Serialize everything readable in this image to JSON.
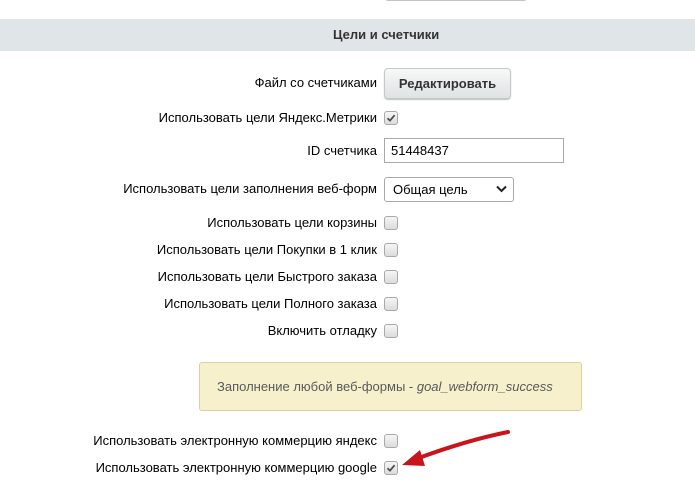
{
  "section": {
    "title": "Цели и счетчики"
  },
  "counters_file": {
    "label": "Файл со счетчиками",
    "button_label": "Редактировать"
  },
  "use_yandex_goals": {
    "label": "Использовать цели Яндекс.Метрики",
    "checked": true
  },
  "counter_id": {
    "label": "ID счетчика",
    "value": "51448437"
  },
  "webform_goals": {
    "label": "Использовать цели заполнения веб-форм",
    "selected": "Общая цель"
  },
  "cart_goals": {
    "label": "Использовать цели корзины",
    "checked": false
  },
  "one_click_goals": {
    "label": "Использовать цели Покупки в 1 клик",
    "checked": false
  },
  "quick_order_goals": {
    "label": "Использовать цели Быстрого заказа",
    "checked": false
  },
  "full_order_goals": {
    "label": "Использовать цели Полного заказа",
    "checked": false
  },
  "debug": {
    "label": "Включить отладку",
    "checked": false
  },
  "note": {
    "text": "Заполнение любой веб-формы - ",
    "goal": "goal_webform_success"
  },
  "ecommerce_yandex": {
    "label": "Использовать электронную коммерцию яндекс",
    "checked": false
  },
  "ecommerce_google": {
    "label": "Использовать электронную коммерцию google",
    "checked": true
  },
  "colors": {
    "header_bg": "#e0e6e7",
    "note_bg": "#f6f1cc",
    "arrow": "#c8151b"
  }
}
